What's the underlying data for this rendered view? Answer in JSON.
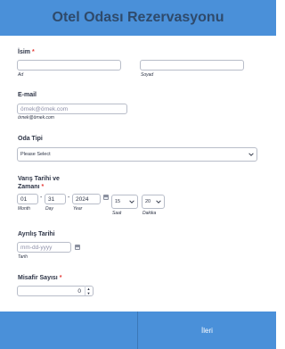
{
  "form": {
    "title": "Otel Odası Rezervasyonu",
    "name": {
      "label": "İsim",
      "required": "*",
      "first_value": "",
      "first_sub": "Ad",
      "last_value": "",
      "last_sub": "Soyad"
    },
    "email": {
      "label": "E-mail",
      "placeholder": "örnek@örnek.com",
      "sub": "örnek@örnek.com"
    },
    "room_type": {
      "label": "Oda Tipi",
      "selected": "Please Select"
    },
    "arrival": {
      "label_line1": "Varış Tarihi ve",
      "label_line2": "Zamanı",
      "required": "*",
      "month": "01",
      "day": "31",
      "year": "2024",
      "sep1": "-",
      "sep2": "-",
      "month_sub": "Month",
      "day_sub": "Day",
      "year_sub": "Year",
      "hour": "15",
      "minute": "20",
      "hour_sub": "Saat",
      "minute_sub": "Dakika"
    },
    "departure": {
      "label": "Ayrılış Tarihi",
      "placeholder": "mm-dd-yyyy",
      "sub": "Tarih"
    },
    "guests": {
      "label": "Misafir Sayısı",
      "required": "*",
      "value": "0",
      "up": "▲",
      "down": "▼"
    }
  },
  "footer": {
    "next_label": "İleri"
  },
  "colors": {
    "header_bg": "#4a90d9",
    "footer_bg": "#4a90d9",
    "required": "#e53935"
  }
}
